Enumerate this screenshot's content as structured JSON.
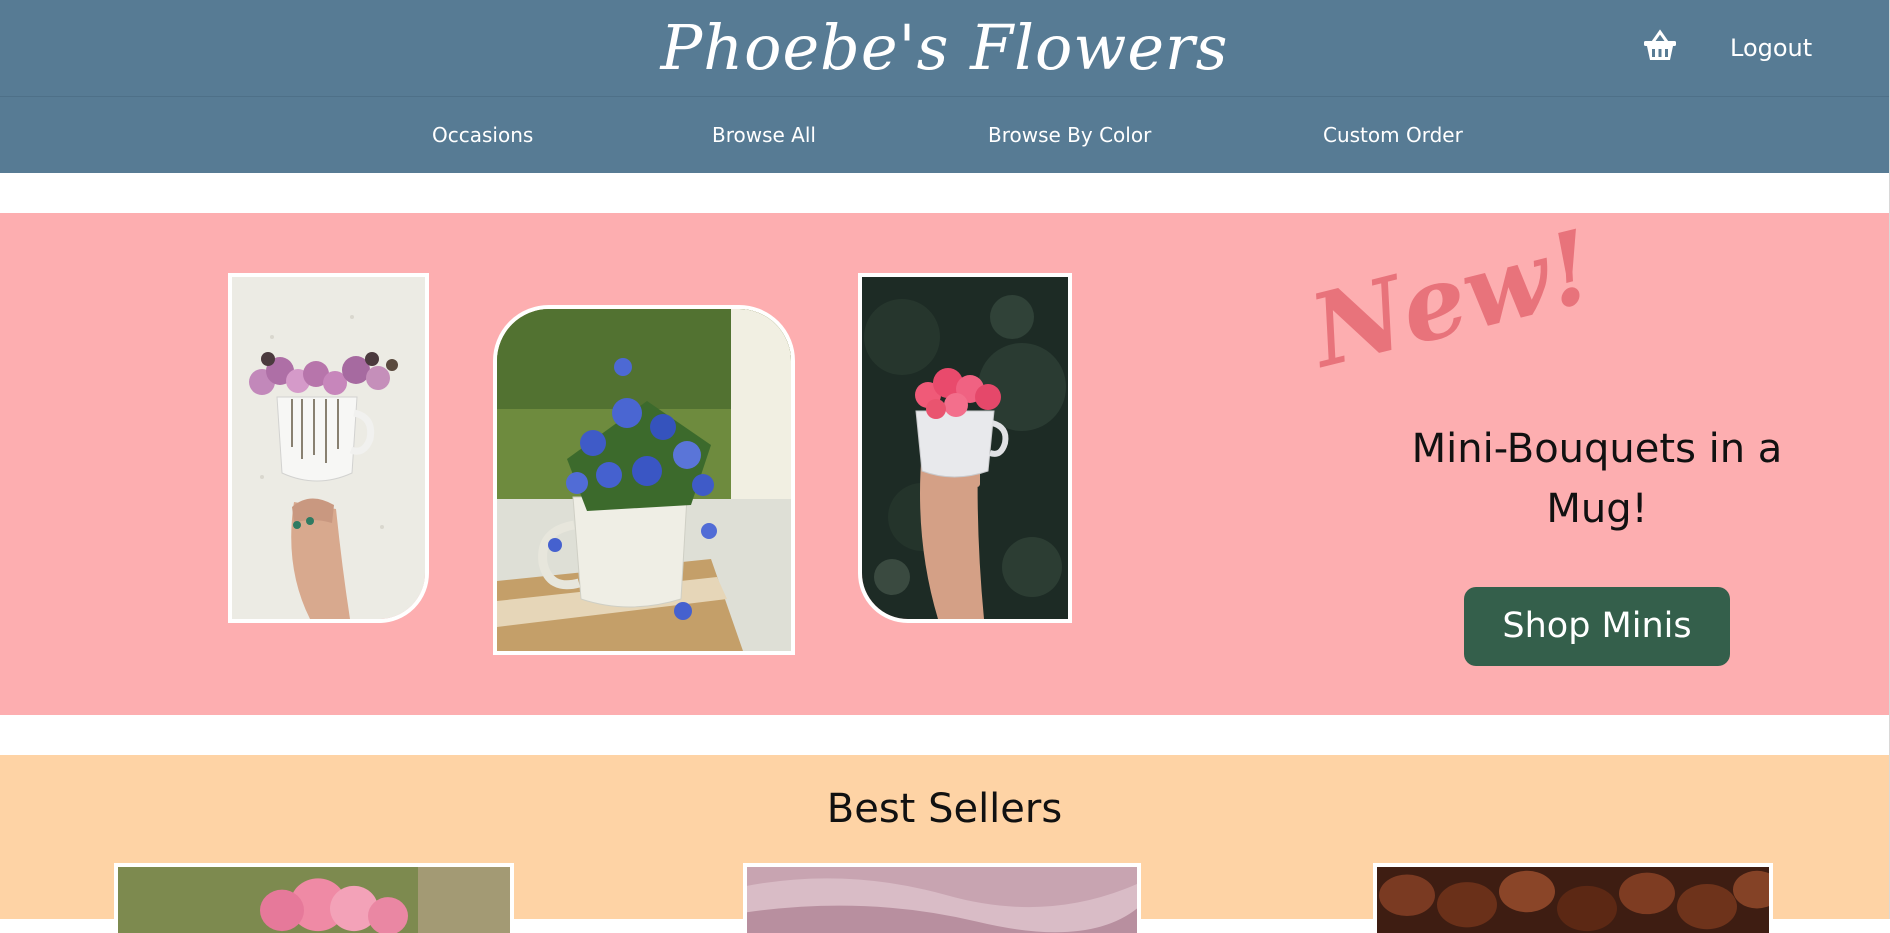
{
  "header": {
    "brand": "Phoebe's Flowers",
    "basket_icon": "basket-icon",
    "logout_label": "Logout"
  },
  "nav": {
    "items": [
      {
        "label": "Occasions"
      },
      {
        "label": "Browse All"
      },
      {
        "label": "Browse By Color"
      },
      {
        "label": "Custom Order"
      }
    ]
  },
  "hero": {
    "tag": "New!",
    "headline": "Mini-Bouquets in a Mug!",
    "cta_label": "Shop Minis"
  },
  "best_sellers": {
    "title": "Best Sellers"
  },
  "colors": {
    "header_bg": "#577b94",
    "hero_bg": "#fdaeb0",
    "accent_new": "#e8737b",
    "cta_bg": "#345f4b",
    "best_bg": "#fed3a5"
  }
}
